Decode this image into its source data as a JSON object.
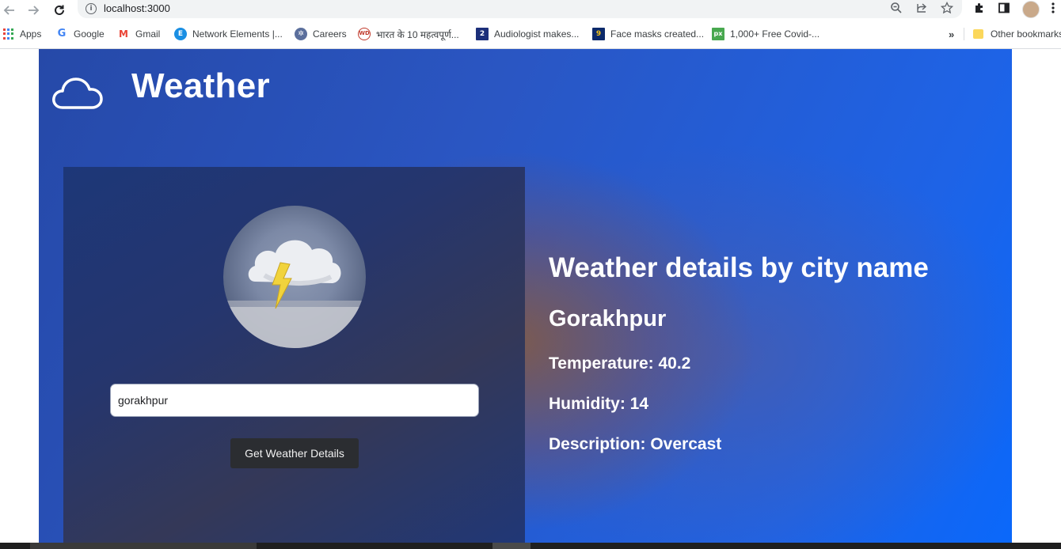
{
  "browser": {
    "url": "localhost:3000",
    "bookmarks": [
      {
        "label": "Apps",
        "icon": "apps-grid-icon"
      },
      {
        "label": "Google",
        "icon": "google-icon",
        "color": "#4285f4"
      },
      {
        "label": "Gmail",
        "icon": "gmail-icon",
        "color": "#ea4335"
      },
      {
        "label": "Network Elements |...",
        "icon": "network-elements-icon",
        "color": "#1a8fe3"
      },
      {
        "label": "Careers",
        "icon": "careers-icon",
        "color": "#5b6f9c"
      },
      {
        "label": "भारत के 10 महत्वपूर्ण...",
        "icon": "wd-icon",
        "color": "#c0392b"
      },
      {
        "label": "Audiologist makes...",
        "icon": "fox2-icon",
        "color": "#1c2f7a"
      },
      {
        "label": "Face masks created...",
        "icon": "nine-news-icon",
        "color": "#0c2a6b"
      },
      {
        "label": "1,000+ Free Covid-...",
        "icon": "pixabay-icon",
        "color": "#48a84f"
      }
    ],
    "overflow_label": "»",
    "other_bookmarks": "Other bookmarks"
  },
  "app": {
    "title": "Weather",
    "logo_icon": "cloud-outline-icon",
    "weather_icon": "thunder-cloud-icon",
    "search": {
      "value": "gorakhpur"
    },
    "button_label": "Get Weather Details",
    "details": {
      "heading": "Weather details by city name",
      "city": "Gorakhpur",
      "temperature": "Temperature: 40.2",
      "humidity": "Humidity: 14",
      "description": "Description: Overcast"
    }
  },
  "colors": {
    "page_blue": "#1e63e6",
    "card_navy": "#25366e",
    "button_dark": "#2b2d31",
    "text_white": "#ffffff"
  }
}
